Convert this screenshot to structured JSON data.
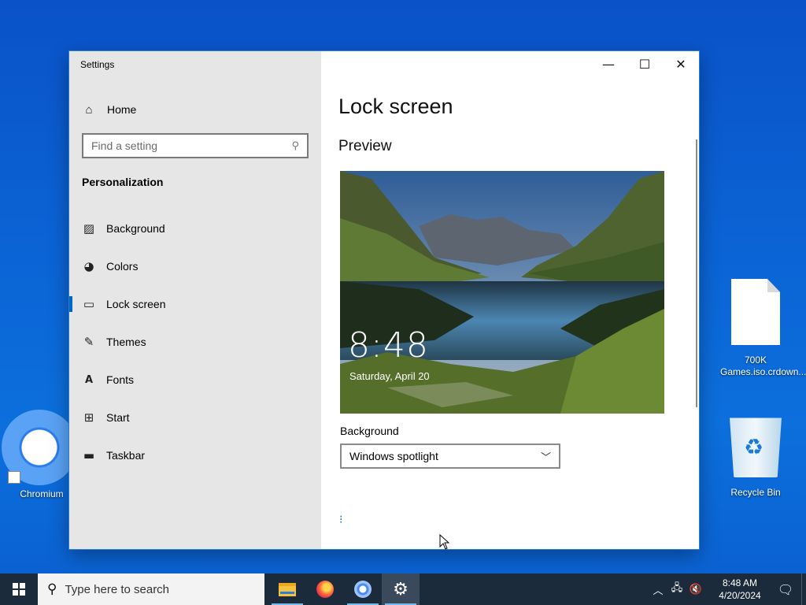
{
  "desktop": {
    "icons": [
      {
        "label": "Chromium"
      },
      {
        "label": "700K\nGames.iso.crdown..."
      },
      {
        "label": "Recycle Bin"
      }
    ]
  },
  "window": {
    "title": "Settings",
    "controls": {
      "minimize": "—",
      "maximize": "☐",
      "close": "✕"
    }
  },
  "sidebar": {
    "home_label": "Home",
    "search_placeholder": "Find a setting",
    "section_title": "Personalization",
    "items": [
      {
        "label": "Background",
        "icon": "picture-icon",
        "active": false
      },
      {
        "label": "Colors",
        "icon": "palette-icon",
        "active": false
      },
      {
        "label": "Lock screen",
        "icon": "lock-screen-icon",
        "active": true
      },
      {
        "label": "Themes",
        "icon": "themes-icon",
        "active": false
      },
      {
        "label": "Fonts",
        "icon": "fonts-icon",
        "active": false
      },
      {
        "label": "Start",
        "icon": "start-icon",
        "active": false
      },
      {
        "label": "Taskbar",
        "icon": "taskbar-icon",
        "active": false
      }
    ]
  },
  "main": {
    "title": "Lock screen",
    "preview_heading": "Preview",
    "preview_time": "8:48",
    "preview_date": "Saturday, April 20",
    "background_label": "Background",
    "background_value": "Windows spotlight"
  },
  "taskbar": {
    "search_placeholder": "Type here to search",
    "apps": [
      "file-explorer",
      "firefox",
      "chromium",
      "settings"
    ],
    "clock_time": "8:48 AM",
    "clock_date": "4/20/2024"
  },
  "colors": {
    "accent": "#0067c0",
    "desktop": "#0b63d4",
    "taskbar": "#1c2b3c",
    "sidebar": "#e6e6e6"
  }
}
